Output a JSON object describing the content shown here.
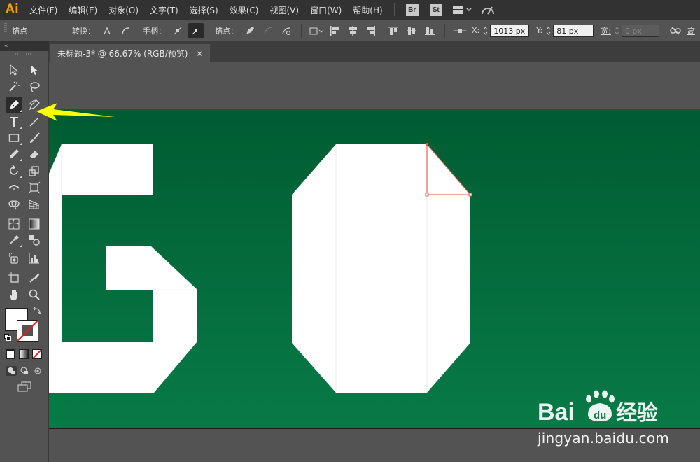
{
  "app": {
    "logo": "Ai"
  },
  "menu": [
    "文件(F)",
    "编辑(E)",
    "对象(O)",
    "文字(T)",
    "选择(S)",
    "效果(C)",
    "视图(V)",
    "窗口(W)",
    "帮助(H)"
  ],
  "menubar_badges": {
    "bridge": "Br",
    "stock": "St"
  },
  "controlbar": {
    "mode_label": "锚点",
    "convert_label": "转换：",
    "handles_label": "手柄：",
    "anchors_label": "锚点：",
    "x_label": "X:",
    "x_value": "1013 px",
    "y_label": "Y:",
    "y_value": "81 px",
    "w_label": "宽:",
    "w_value": "0 px",
    "h_label": "高"
  },
  "document_tab": {
    "title": "未标题-3* @ 66.67% (RGB/预览)",
    "close": "×"
  },
  "canvas": {
    "artboard_color": "#006b3c",
    "artwork_fill": "#ffffff",
    "selection_color": "#e8534b"
  },
  "annotation": {
    "arrow_color": "#ffff00"
  },
  "watermark": {
    "brand": "Bai du 经验",
    "url": "jingyan.baidu.com"
  },
  "colors": {
    "fill_swatch": "#ffffff",
    "stroke_swatch": "none"
  }
}
